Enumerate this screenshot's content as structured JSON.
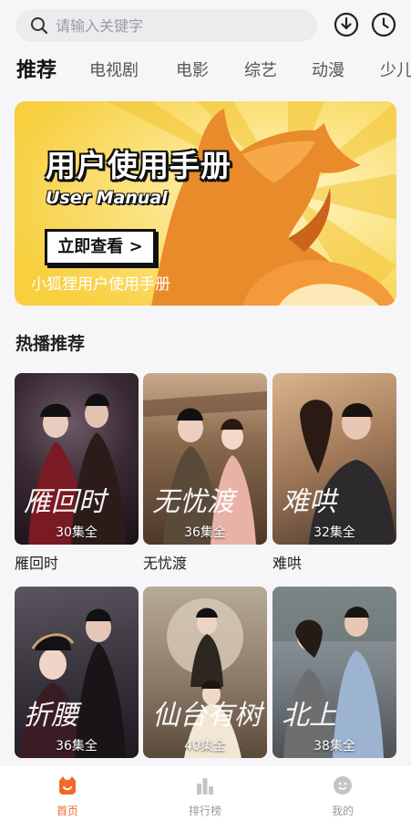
{
  "search": {
    "placeholder": "请输入关键字"
  },
  "header_icons": [
    "download-icon",
    "history-icon"
  ],
  "tabs": [
    {
      "label": "推荐",
      "active": true
    },
    {
      "label": "电视剧",
      "active": false
    },
    {
      "label": "电影",
      "active": false
    },
    {
      "label": "综艺",
      "active": false
    },
    {
      "label": "动漫",
      "active": false
    },
    {
      "label": "少儿",
      "active": false
    }
  ],
  "banner": {
    "title": "用户使用手册",
    "subtitle": "User Manual",
    "button": "立即查看 >",
    "caption": "小狐狸用户使用手册"
  },
  "section": {
    "title": "热播推荐"
  },
  "dramas": [
    {
      "name": "雁回时",
      "episodes": "30集全",
      "calligraphy": "雁回时"
    },
    {
      "name": "无忧渡",
      "episodes": "36集全",
      "calligraphy": "无忧渡"
    },
    {
      "name": "难哄",
      "episodes": "32集全",
      "calligraphy": "难哄"
    },
    {
      "name": "",
      "episodes": "36集全",
      "calligraphy": "折腰"
    },
    {
      "name": "",
      "episodes": "40集全",
      "calligraphy": "仙台有树"
    },
    {
      "name": "",
      "episodes": "38集全",
      "calligraphy": "北上"
    }
  ],
  "bottom_nav": [
    {
      "label": "首页",
      "icon": "home-icon",
      "active": true
    },
    {
      "label": "排行榜",
      "icon": "ranking-icon",
      "active": false
    },
    {
      "label": "我的",
      "icon": "profile-icon",
      "active": false
    }
  ],
  "colors": {
    "accent": "#f06a28",
    "banner_yellow": "#f9d24a",
    "fox_orange": "#e98a2b"
  }
}
